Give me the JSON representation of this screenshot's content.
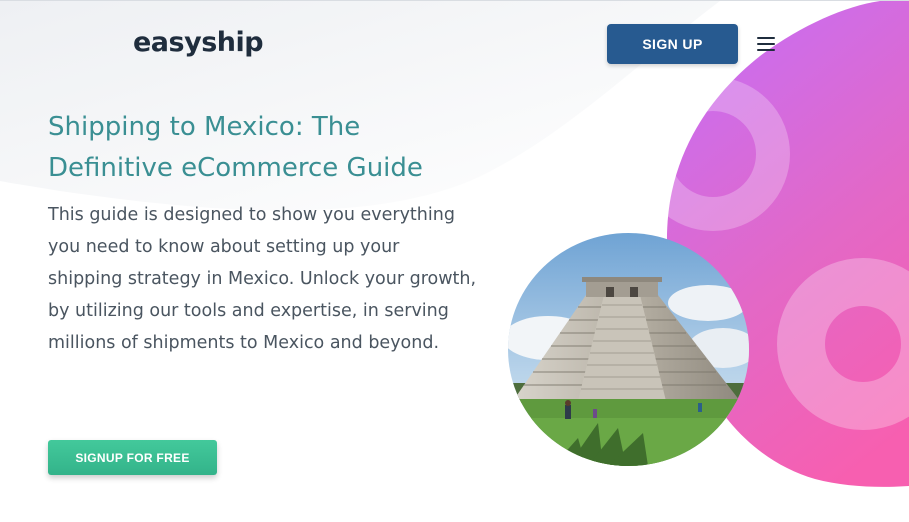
{
  "header": {
    "logo_text": "easyship",
    "signup_label": "SIGN UP",
    "menu_icon": "hamburger-menu-icon"
  },
  "hero": {
    "title_line1": "Shipping to Mexico: The",
    "title_line2": "Definitive eCommerce Guide",
    "description": "This guide is designed to show you everything you need to know about setting up your shipping strategy in Mexico. Unlock your growth, by utilizing our tools and expertise, in serving millions of shipments to Mexico and beyond.",
    "cta_label": "SIGNUP FOR FREE",
    "image": "chichen-itza-pyramid-photo"
  },
  "colors": {
    "brand_blue": "#275a90",
    "title_teal": "#3a8f93",
    "cta_green": "#3bbf92",
    "blob_pink": "#f25fb4",
    "blob_purple": "#c86ef2",
    "text_gray": "#4a5560"
  }
}
